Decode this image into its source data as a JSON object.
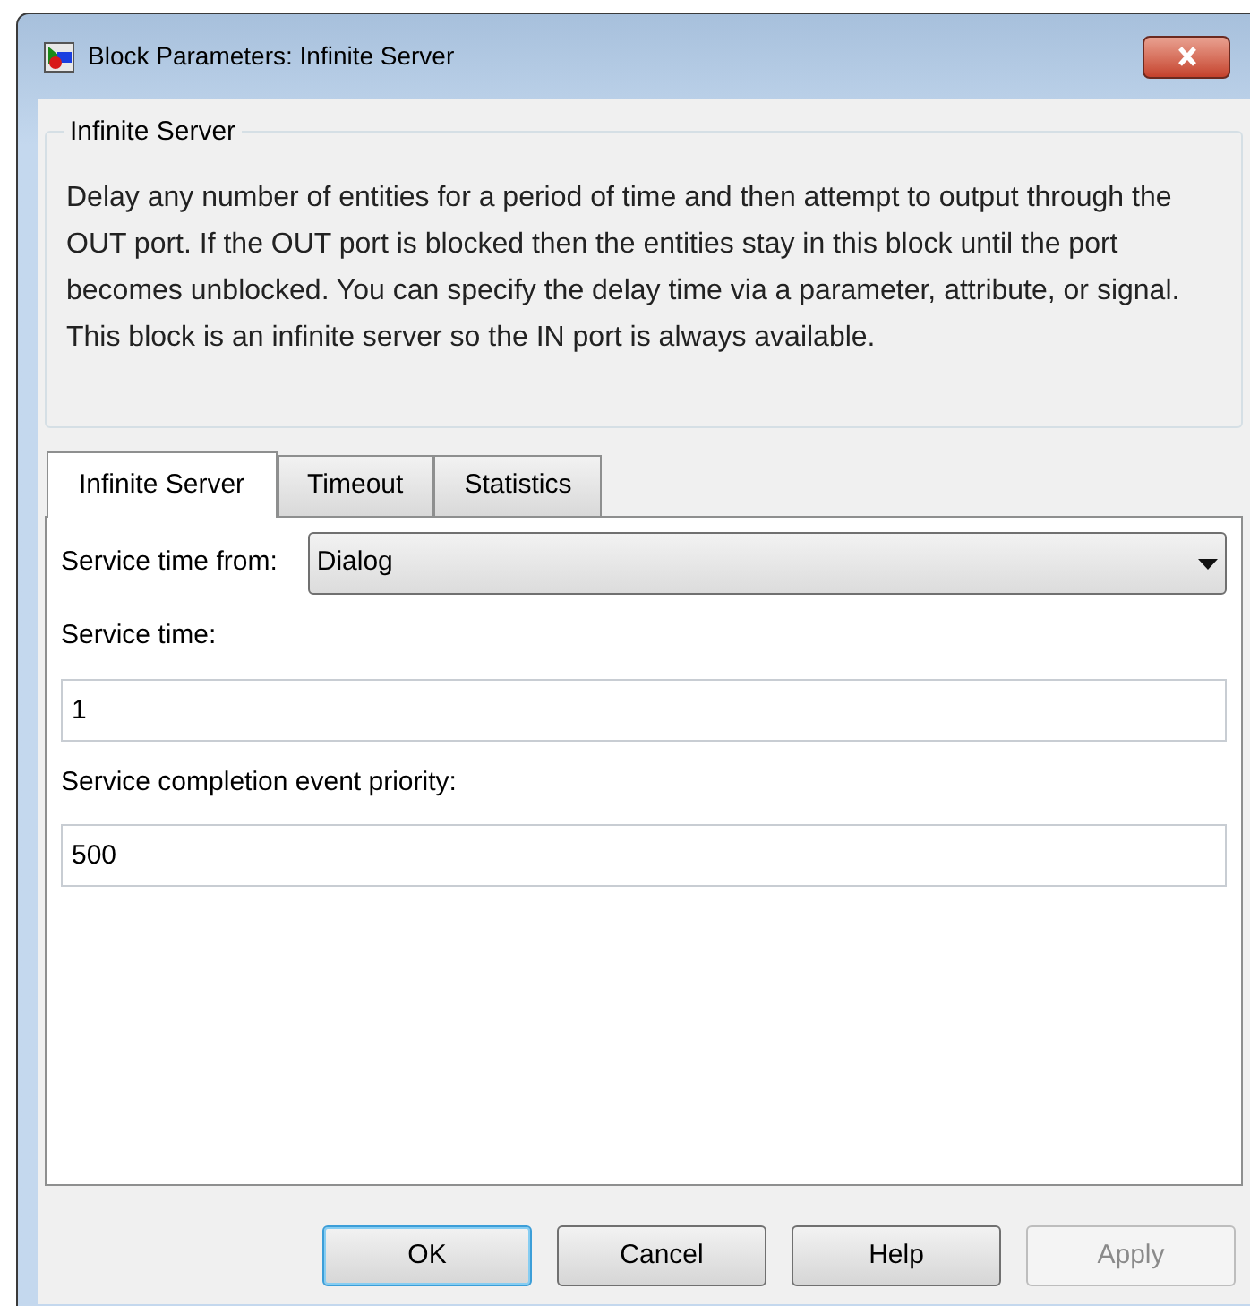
{
  "window": {
    "title": "Block Parameters: Infinite Server"
  },
  "group": {
    "title": "Infinite Server",
    "paragraphs": [
      "Delay any number of entities for a period of time and then attempt to output through the OUT port. If the OUT port is blocked then the entities stay in this block until the port becomes unblocked. You can specify the delay time via a parameter, attribute, or signal.",
      "This block is an infinite server so the IN port is always available."
    ]
  },
  "tabs": [
    {
      "label": "Infinite Server",
      "selected": true
    },
    {
      "label": "Timeout",
      "selected": false
    },
    {
      "label": "Statistics",
      "selected": false
    }
  ],
  "service_time_from": {
    "label": "Service time from:",
    "value": "Dialog"
  },
  "fields": [
    {
      "label": "Service time:",
      "value": "1"
    },
    {
      "label": "Service completion event priority:",
      "value": "500"
    }
  ],
  "buttons": [
    {
      "label": "OK",
      "default": true,
      "disabled": false
    },
    {
      "label": "Cancel",
      "default": false,
      "disabled": false
    },
    {
      "label": "Help",
      "default": false,
      "disabled": false
    },
    {
      "label": "Apply",
      "default": false,
      "disabled": true
    }
  ]
}
